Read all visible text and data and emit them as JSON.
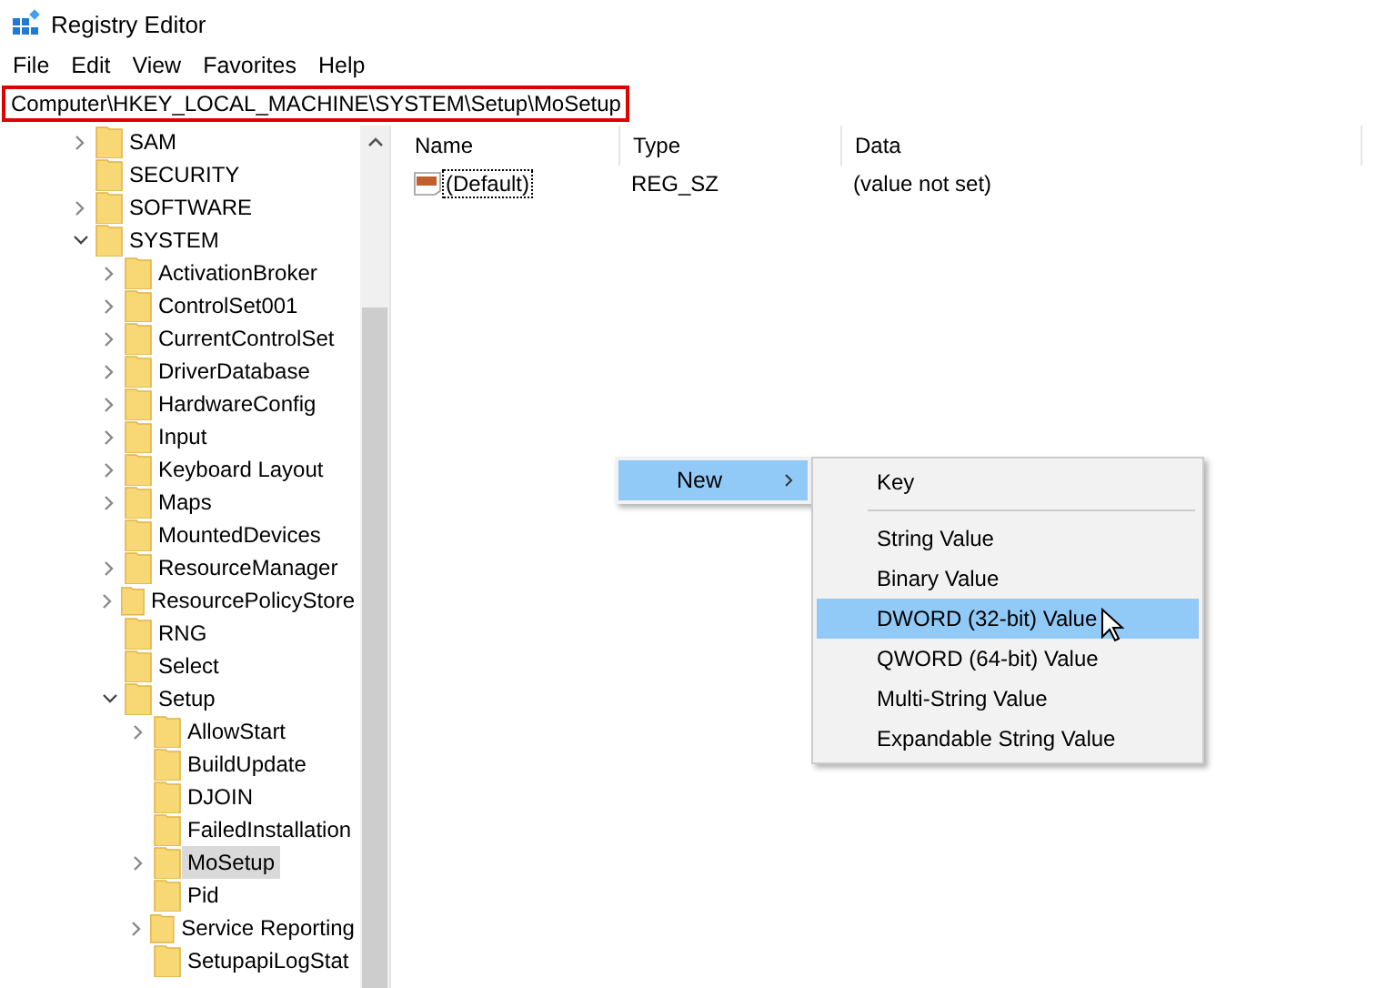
{
  "window": {
    "title": "Registry Editor"
  },
  "menu": [
    {
      "label": "File"
    },
    {
      "label": "Edit"
    },
    {
      "label": "View"
    },
    {
      "label": "Favorites"
    },
    {
      "label": "Help"
    }
  ],
  "address": {
    "value": "Computer\\HKEY_LOCAL_MACHINE\\SYSTEM\\Setup\\MoSetup"
  },
  "tree": [
    {
      "label": "SAM",
      "kind": "collapsed",
      "selected": false
    },
    {
      "label": "SECURITY",
      "kind": "leaf",
      "selected": false
    },
    {
      "label": "SOFTWARE",
      "kind": "collapsed",
      "selected": false
    },
    {
      "label": "SYSTEM",
      "kind": "expanded",
      "selected": false,
      "children": [
        {
          "label": "ActivationBroker",
          "kind": "collapsed",
          "selected": false
        },
        {
          "label": "ControlSet001",
          "kind": "collapsed",
          "selected": false
        },
        {
          "label": "CurrentControlSet",
          "kind": "collapsed",
          "selected": false
        },
        {
          "label": "DriverDatabase",
          "kind": "collapsed",
          "selected": false
        },
        {
          "label": "HardwareConfig",
          "kind": "collapsed",
          "selected": false
        },
        {
          "label": "Input",
          "kind": "collapsed",
          "selected": false
        },
        {
          "label": "Keyboard Layout",
          "kind": "collapsed",
          "selected": false
        },
        {
          "label": "Maps",
          "kind": "collapsed",
          "selected": false
        },
        {
          "label": "MountedDevices",
          "kind": "leaf",
          "selected": false
        },
        {
          "label": "ResourceManager",
          "kind": "collapsed",
          "selected": false
        },
        {
          "label": "ResourcePolicyStore",
          "kind": "collapsed",
          "selected": false
        },
        {
          "label": "RNG",
          "kind": "leaf",
          "selected": false
        },
        {
          "label": "Select",
          "kind": "leaf",
          "selected": false
        },
        {
          "label": "Setup",
          "kind": "expanded",
          "selected": false,
          "children": [
            {
              "label": "AllowStart",
              "kind": "collapsed",
              "selected": false
            },
            {
              "label": "BuildUpdate",
              "kind": "leaf",
              "selected": false
            },
            {
              "label": "DJOIN",
              "kind": "leaf",
              "selected": false
            },
            {
              "label": "FailedInstallation",
              "kind": "leaf",
              "selected": false
            },
            {
              "label": "MoSetup",
              "kind": "collapsed",
              "selected": true
            },
            {
              "label": "Pid",
              "kind": "leaf",
              "selected": false
            },
            {
              "label": "Service Reporting",
              "kind": "collapsed",
              "selected": false
            },
            {
              "label": "SetupapiLogStat",
              "kind": "leaf",
              "selected": false
            }
          ]
        }
      ]
    }
  ],
  "columns": [
    "Name",
    "Type",
    "Data"
  ],
  "values": [
    {
      "name": "(Default)",
      "type": "REG_SZ",
      "data": "(value not set)",
      "focused": true
    }
  ],
  "context_menu": {
    "label": "New",
    "selected": true
  },
  "submenu": [
    {
      "kind": "item",
      "label": "Key",
      "selected": false
    },
    {
      "kind": "separator"
    },
    {
      "kind": "item",
      "label": "String Value",
      "selected": false
    },
    {
      "kind": "item",
      "label": "Binary Value",
      "selected": false
    },
    {
      "kind": "item",
      "label": "DWORD (32-bit) Value",
      "selected": true
    },
    {
      "kind": "item",
      "label": "QWORD (64-bit) Value",
      "selected": false
    },
    {
      "kind": "item",
      "label": "Multi-String Value",
      "selected": false
    },
    {
      "kind": "item",
      "label": "Expandable String Value",
      "selected": false
    }
  ]
}
